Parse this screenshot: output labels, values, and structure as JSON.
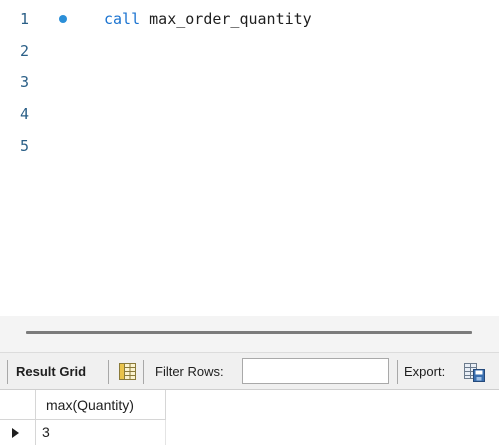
{
  "editor": {
    "lines": [
      {
        "number": "1",
        "keyword": "call",
        "rest": " max_order_quantity",
        "has_marker": true
      },
      {
        "number": "2",
        "keyword": "",
        "rest": "",
        "has_marker": false
      },
      {
        "number": "3",
        "keyword": "",
        "rest": "",
        "has_marker": false
      },
      {
        "number": "4",
        "keyword": "",
        "rest": "",
        "has_marker": false
      },
      {
        "number": "5",
        "keyword": "",
        "rest": "",
        "has_marker": false
      }
    ],
    "keyword_color": "#1a73d0",
    "line_number_color": "#2a5f87",
    "marker_color": "#2b8fd8"
  },
  "toolbar": {
    "result_grid_label": "Result Grid",
    "grid_icon": "grid-layout-icon",
    "filter_label": "Filter Rows:",
    "filter_value": "",
    "export_label": "Export:",
    "export_icon": "export-table-icon"
  },
  "result": {
    "columns": [
      "max(Quantity)"
    ],
    "rows": [
      [
        "3"
      ]
    ]
  }
}
